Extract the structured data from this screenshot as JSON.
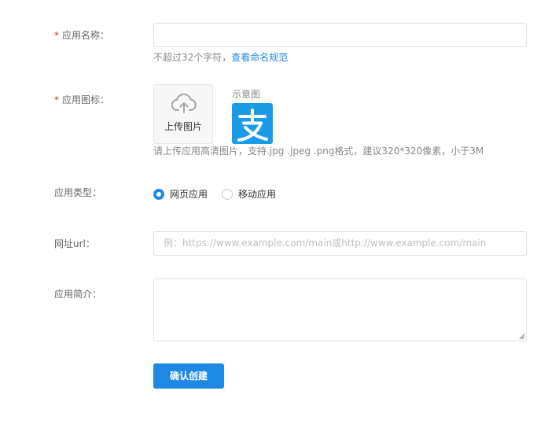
{
  "form": {
    "app_name": {
      "required_mark": "*",
      "label": "应用名称：",
      "value": "",
      "help_text": "不超过32个字符，",
      "help_link": "查看命名规范"
    },
    "app_icon": {
      "required_mark": "*",
      "label": "应用图标：",
      "upload_label": "上传图片",
      "sample_label": "示意图",
      "sample_logo": "alipay-logo-icon",
      "help_text": "请上传应用高清图片，支持.jpg .jpeg .png格式，建议320*320像素，小于3M"
    },
    "app_type": {
      "label": "应用类型：",
      "options": [
        {
          "label": "网页应用",
          "checked": true
        },
        {
          "label": "移动应用",
          "checked": false
        }
      ]
    },
    "url": {
      "label": "网址url：",
      "value": "",
      "placeholder": "例：https://www.example.com/main或http://www.example.com/main"
    },
    "description": {
      "label": "应用简介：",
      "value": ""
    },
    "submit_label": "确认创建"
  },
  "colors": {
    "accent": "#1e88e5",
    "required": "#e02b2b",
    "logo_bg": "#1a9be6"
  }
}
